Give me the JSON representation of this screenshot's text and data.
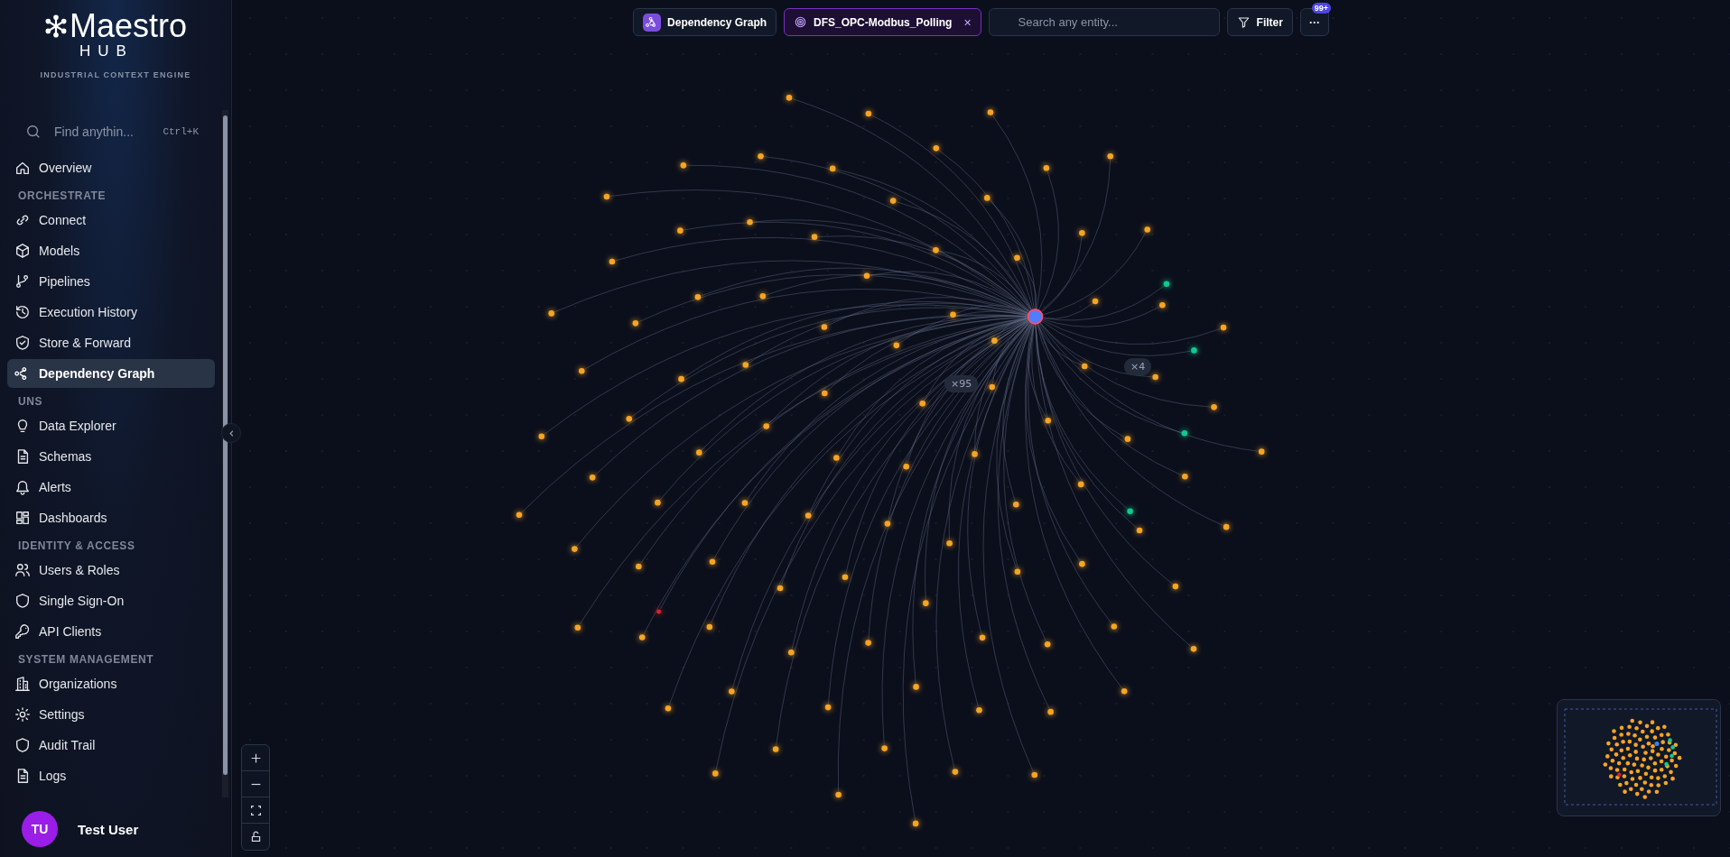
{
  "sidebar": {
    "logo": {
      "name": "Maestro",
      "sub": "HUB",
      "tagline": "INDUSTRIAL CONTEXT ENGINE"
    },
    "search": {
      "placeholder": "Find anythin...",
      "shortcut": "Ctrl+K"
    },
    "items": [
      {
        "kind": "link",
        "label": "Overview",
        "selected": false
      },
      {
        "kind": "section",
        "label": "ORCHESTRATE"
      },
      {
        "kind": "link",
        "label": "Connect",
        "selected": false
      },
      {
        "kind": "link",
        "label": "Models",
        "selected": false
      },
      {
        "kind": "link",
        "label": "Pipelines",
        "selected": false
      },
      {
        "kind": "link",
        "label": "Execution History",
        "selected": false
      },
      {
        "kind": "link",
        "label": "Store & Forward",
        "selected": false
      },
      {
        "kind": "link",
        "label": "Dependency Graph",
        "selected": true
      },
      {
        "kind": "section",
        "label": "UNS"
      },
      {
        "kind": "link",
        "label": "Data Explorer",
        "selected": false
      },
      {
        "kind": "link",
        "label": "Schemas",
        "selected": false
      },
      {
        "kind": "link",
        "label": "Alerts",
        "selected": false
      },
      {
        "kind": "link",
        "label": "Dashboards",
        "selected": false
      },
      {
        "kind": "section",
        "label": "IDENTITY & ACCESS"
      },
      {
        "kind": "link",
        "label": "Users & Roles",
        "selected": false
      },
      {
        "kind": "link",
        "label": "Single Sign-On",
        "selected": false
      },
      {
        "kind": "link",
        "label": "API Clients",
        "selected": false
      },
      {
        "kind": "section",
        "label": "SYSTEM MANAGEMENT"
      },
      {
        "kind": "link",
        "label": "Organizations",
        "selected": false
      },
      {
        "kind": "link",
        "label": "Settings",
        "selected": false
      },
      {
        "kind": "link",
        "label": "Audit Trail",
        "selected": false
      },
      {
        "kind": "link",
        "label": "Logs",
        "selected": false
      }
    ],
    "user": {
      "initials": "TU",
      "name": "Test User"
    }
  },
  "toolbar": {
    "view_tab": "Dependency Graph",
    "focus_chip": {
      "label": "DFS_OPC-Modbus_Polling",
      "close": "×"
    },
    "search": {
      "placeholder": "Search any entity..."
    },
    "filter": "Filter",
    "more": "···",
    "badge": "99+"
  },
  "graph": {
    "edge_labels": [
      "×95",
      "×4"
    ],
    "nodes": [
      {
        "color": "#f5a524"
      },
      {
        "color": "#f5a524"
      },
      {
        "color": "#f5a524"
      },
      {
        "color": "#f5a524"
      },
      {
        "color": "#f5a524"
      },
      {
        "color": "#f5a524"
      },
      {
        "color": "#f5a524"
      },
      {
        "color": "#f5a524"
      },
      {
        "color": "#f5a524"
      },
      {
        "color": "#f5a524"
      },
      {
        "color": "#f5a524"
      },
      {
        "color": "#f5a524"
      },
      {
        "color": "#f5a524"
      },
      {
        "color": "#f5a524"
      },
      {
        "color": "#f5a524"
      },
      {
        "color": "#f5a524"
      },
      {
        "color": "#f5a524"
      },
      {
        "color": "#f5a524"
      },
      {
        "color": "#f5a524"
      },
      {
        "color": "#f5a524"
      },
      {
        "color": "#f5a524"
      },
      {
        "color": "#f5a524"
      },
      {
        "color": "#f5a524"
      },
      {
        "color": "#f5a524"
      },
      {
        "color": "#f5a524"
      },
      {
        "color": "#f5a524"
      },
      {
        "color": "#f5a524"
      },
      {
        "color": "#f5a524"
      },
      {
        "color": "#f5a524"
      },
      {
        "color": "#f5a524"
      },
      {
        "color": "#f5a524"
      },
      {
        "color": "#f5a524"
      },
      {
        "color": "#f5a524"
      },
      {
        "color": "#f5a524"
      },
      {
        "color": "#f5a524"
      },
      {
        "color": "#f5a524"
      },
      {
        "color": "#f5a524"
      },
      {
        "color": "#f5a524"
      },
      {
        "color": "#f5a524"
      },
      {
        "color": "#f5a524"
      },
      {
        "color": "#f5a524"
      },
      {
        "color": "#f5a524"
      },
      {
        "color": "#f5a524"
      },
      {
        "color": "#f5a524"
      },
      {
        "color": "#f5a524"
      },
      {
        "color": "#f5a524"
      },
      {
        "color": "#f5a524"
      },
      {
        "color": "#f5a524"
      },
      {
        "color": "#f5a524"
      },
      {
        "color": "#f5a524"
      },
      {
        "color": "#f5a524"
      },
      {
        "color": "#f5a524"
      },
      {
        "color": "#f5a524"
      },
      {
        "color": "#f5a524"
      },
      {
        "color": "#f5a524"
      },
      {
        "color": "#f5a524"
      },
      {
        "color": "#f5a524"
      },
      {
        "color": "#f5a524"
      },
      {
        "color": "#f5a524"
      },
      {
        "color": "#f5a524"
      },
      {
        "color": "#f5a524"
      },
      {
        "color": "#f5a524"
      },
      {
        "color": "#f5a524"
      },
      {
        "color": "#f5a524"
      },
      {
        "color": "#f5a524"
      },
      {
        "color": "#f5a524"
      },
      {
        "color": "#f5a524"
      },
      {
        "color": "#f5a524"
      },
      {
        "color": "#f5a524"
      },
      {
        "color": "#f5a524"
      },
      {
        "color": "#f5a524"
      },
      {
        "color": "#f5a524"
      },
      {
        "color": "#f5a524"
      },
      {
        "color": "#f5a524"
      },
      {
        "color": "#f5a524"
      },
      {
        "color": "#f5a524"
      },
      {
        "color": "#f5a524"
      },
      {
        "color": "#f5a524"
      },
      {
        "color": "#f5a524"
      },
      {
        "color": "#f5a524"
      },
      {
        "color": "#f5a524"
      },
      {
        "color": "#f5a524"
      },
      {
        "color": "#f5a524"
      },
      {
        "color": "#f5a524"
      },
      {
        "color": "#f5a524"
      },
      {
        "color": "#f5a524"
      },
      {
        "color": "#f5a524"
      },
      {
        "color": "#f5a524"
      },
      {
        "color": "#f5a524"
      },
      {
        "color": "#f5a524"
      },
      {
        "color": "#f5a524"
      },
      {
        "color": "#f5a524"
      },
      {
        "color": "#f5a524"
      },
      {
        "color": "#f5a524"
      },
      {
        "color": "#f5a524"
      },
      {
        "color": "#10c98f"
      },
      {
        "color": "#10c98f"
      },
      {
        "color": "#10c98f"
      },
      {
        "color": "#10c98f"
      },
      {
        "color": "#e11d2a"
      }
    ]
  }
}
